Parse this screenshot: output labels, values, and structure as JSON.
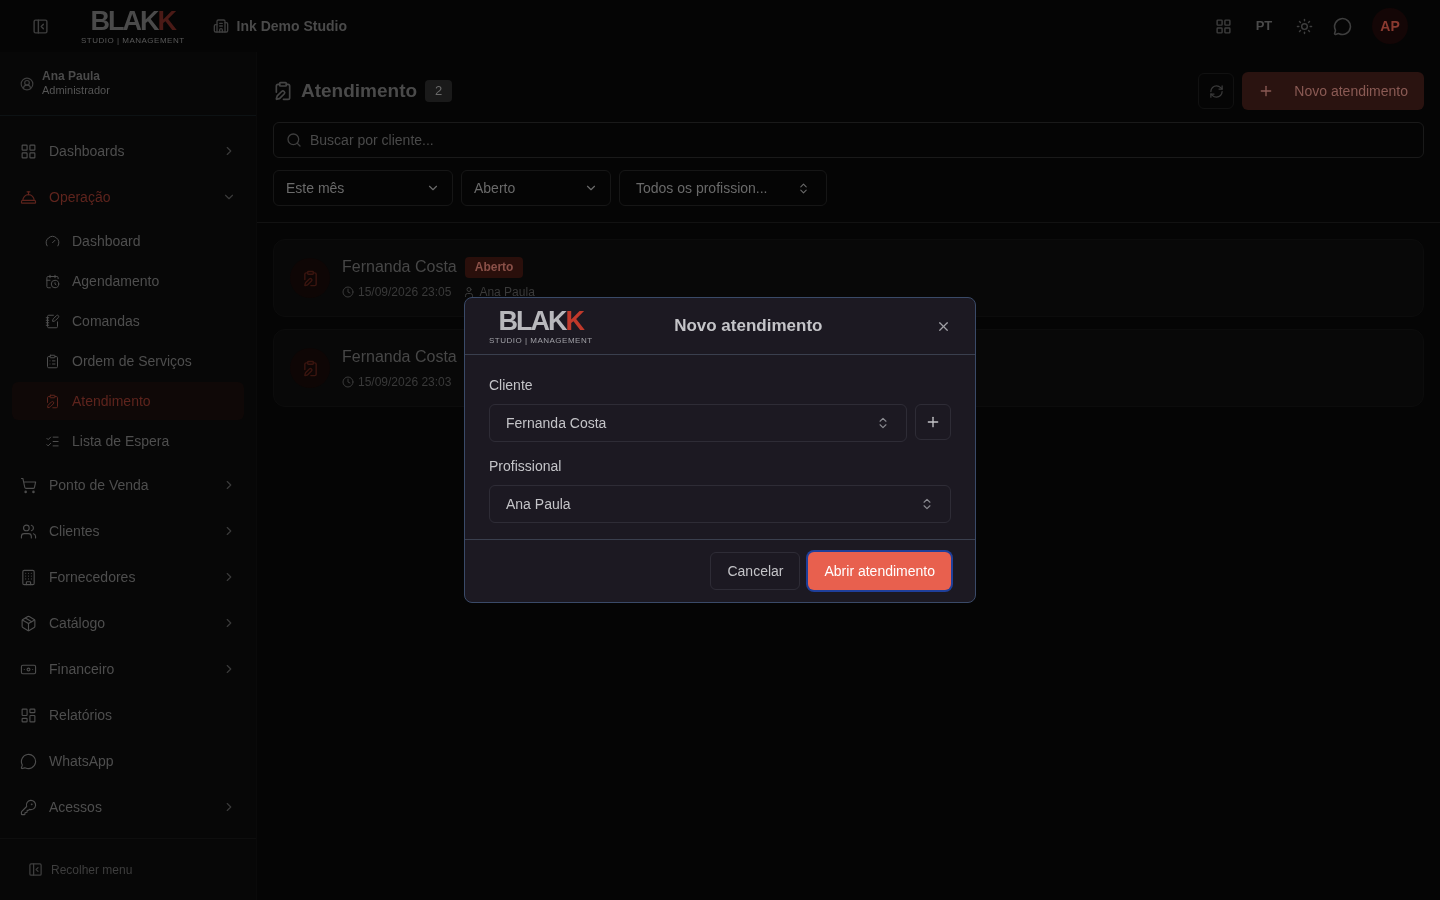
{
  "topbar": {
    "logo": {
      "main": "BLAK",
      "accent": "K",
      "tagline": "STUDIO | MANAGEMENT"
    },
    "studio": "Ink Demo Studio",
    "language": "PT",
    "avatar": "AP"
  },
  "user": {
    "name": "Ana Paula",
    "role": "Administrador"
  },
  "sidebar": {
    "items": [
      {
        "label": "Dashboards",
        "kind": "group",
        "expanded": false,
        "selected": false
      },
      {
        "label": "Operação",
        "kind": "group",
        "expanded": true,
        "selected": true,
        "children": [
          {
            "label": "Dashboard",
            "selected": false
          },
          {
            "label": "Agendamento",
            "selected": false
          },
          {
            "label": "Comandas",
            "selected": false
          },
          {
            "label": "Ordem de Serviços",
            "selected": false
          },
          {
            "label": "Atendimento",
            "selected": true
          },
          {
            "label": "Lista de Espera",
            "selected": false
          }
        ]
      },
      {
        "label": "Ponto de Venda",
        "kind": "group",
        "expanded": false,
        "selected": false
      },
      {
        "label": "Clientes",
        "kind": "group",
        "expanded": false,
        "selected": false
      },
      {
        "label": "Fornecedores",
        "kind": "group",
        "expanded": false,
        "selected": false
      },
      {
        "label": "Catálogo",
        "kind": "group",
        "expanded": false,
        "selected": false
      },
      {
        "label": "Financeiro",
        "kind": "group",
        "expanded": false,
        "selected": false
      },
      {
        "label": "Relatórios",
        "kind": "link",
        "selected": false
      },
      {
        "label": "WhatsApp",
        "kind": "link",
        "selected": false
      },
      {
        "label": "Acessos",
        "kind": "group",
        "expanded": false,
        "selected": false
      }
    ],
    "collapse": "Recolher menu"
  },
  "page": {
    "title": "Atendimento",
    "count": "2",
    "new_button": "Novo atendimento",
    "search": {
      "placeholder": "Buscar por cliente..."
    },
    "filters": [
      {
        "value": "Este mês",
        "kind": "dropdown"
      },
      {
        "value": "Aberto",
        "kind": "dropdown"
      },
      {
        "value": "Todos os profission...",
        "kind": "combobox"
      }
    ],
    "records": [
      {
        "client": "Fernanda Costa",
        "status": "Aberto",
        "time": "15/09/2026 23:05",
        "professional": "Ana Paula"
      },
      {
        "client": "Fernanda Costa",
        "time": "15/09/2026 23:03"
      }
    ]
  },
  "dialog": {
    "title": "Novo atendimento",
    "logo": {
      "main": "BLAK",
      "accent": "K",
      "tagline": "STUDIO | MANAGEMENT"
    },
    "fields": [
      {
        "label": "Cliente",
        "value": "Fernanda Costa",
        "add_button": true
      },
      {
        "label": "Profissional",
        "value": "Ana Paula",
        "add_button": false
      }
    ],
    "buttons": [
      {
        "label": "Cancelar",
        "kind": "secondary"
      },
      {
        "label": "Abrir atendimento",
        "kind": "primary"
      }
    ]
  }
}
